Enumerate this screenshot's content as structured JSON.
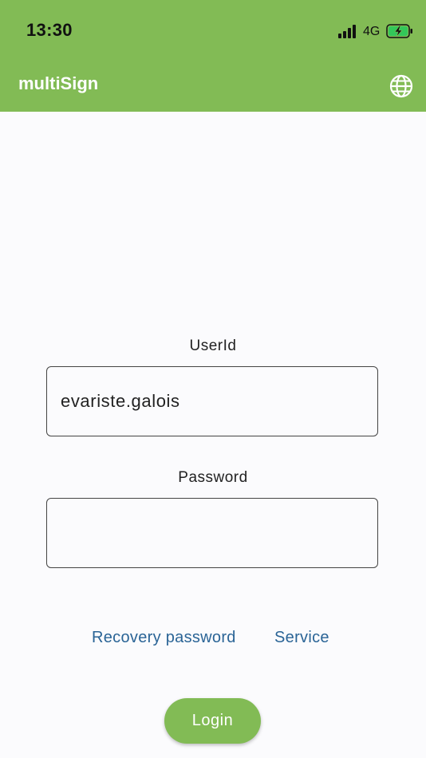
{
  "status_bar": {
    "time": "13:30",
    "network": "4G",
    "icons": [
      "signal-icon",
      "battery-charging-icon"
    ]
  },
  "app_bar": {
    "title": "multiSign",
    "language_icon": "globe-icon",
    "color": "#82bb55"
  },
  "form": {
    "userid_label": "UserId",
    "userid_value": "evariste.galois",
    "password_label": "Password",
    "password_value": ""
  },
  "links": {
    "recovery": "Recovery password",
    "service": "Service",
    "color": "#2a6496"
  },
  "login_button": {
    "label": "Login",
    "color": "#82bb55"
  }
}
